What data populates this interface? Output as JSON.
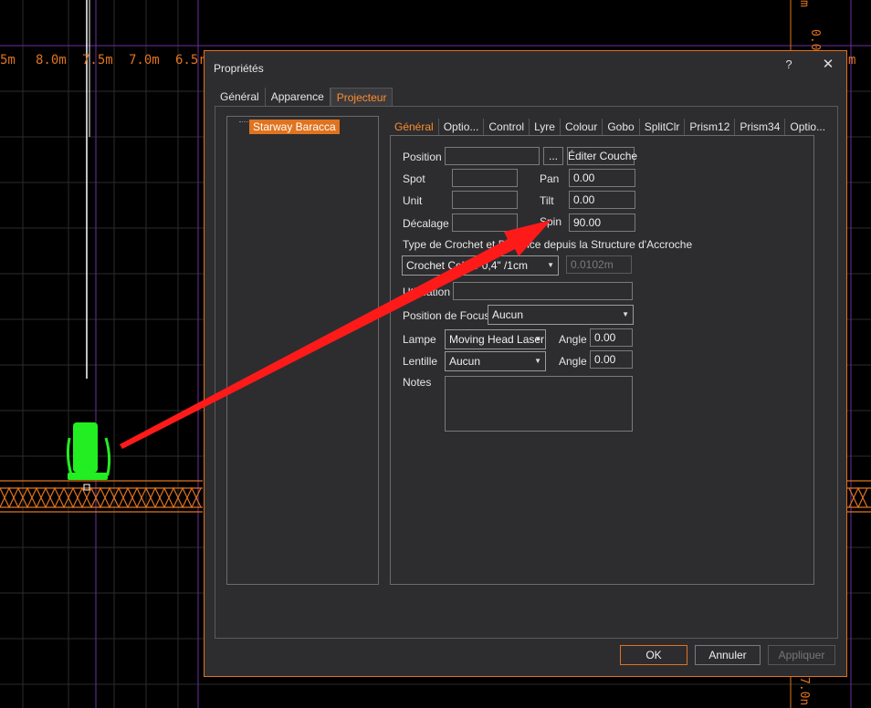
{
  "cad": {
    "ruler_labels": [
      "5m",
      "8.0m",
      "7.5m",
      "7.0m",
      "6.5r",
      "m"
    ],
    "vruler_labels": [
      "0.0",
      "7.0n",
      "m"
    ]
  },
  "dialog": {
    "title": "Propriétés",
    "help": "?",
    "close": "✕",
    "tabs": [
      "Général",
      "Apparence",
      "Projecteur"
    ],
    "active_tab": "Projecteur"
  },
  "tree": {
    "item": "Starway Baracca"
  },
  "inner_tabs": [
    "Général",
    "Optio...",
    "Control",
    "Lyre",
    "Colour",
    "Gobo",
    "SplitClr",
    "Prism12",
    "Prism34",
    "Optio..."
  ],
  "form": {
    "position_label": "Position",
    "position_value": "",
    "browse_label": "...",
    "edit_layer_label": "Éditer Couche",
    "spot_label": "Spot",
    "spot_value": "",
    "unit_label": "Unit",
    "unit_value": "",
    "offset_label": "Décalage",
    "offset_value": "",
    "pan_label": "Pan",
    "pan_value": "0.00",
    "tilt_label": "Tilt",
    "tilt_value": "0.00",
    "spin_label": "Spin",
    "spin_value": "90.00",
    "hook_heading": "Type de Crochet et Distance depuis la Structure d'Accroche",
    "hook_type": "Crochet Collier 0,4\" /1cm",
    "hook_distance": "0.0102m",
    "usage_label": "Utilisation",
    "usage_value": "",
    "focus_label": "Position de Focus",
    "focus_value": "Aucun",
    "lamp_label": "Lampe",
    "lamp_value": "Moving Head Laser",
    "lamp_angle_label": "Angle",
    "lamp_angle_value": "0.00",
    "lens_label": "Lentille",
    "lens_value": "Aucun",
    "lens_angle_label": "Angle",
    "lens_angle_value": "0.00",
    "notes_label": "Notes",
    "notes_value": ""
  },
  "buttons": {
    "ok": "OK",
    "cancel": "Annuler",
    "apply": "Appliquer"
  },
  "colors": {
    "accent": "#e0731f",
    "fixture": "#22ee22",
    "arrow": "#ff1a1a",
    "grid_line": "#6b2fa0"
  }
}
